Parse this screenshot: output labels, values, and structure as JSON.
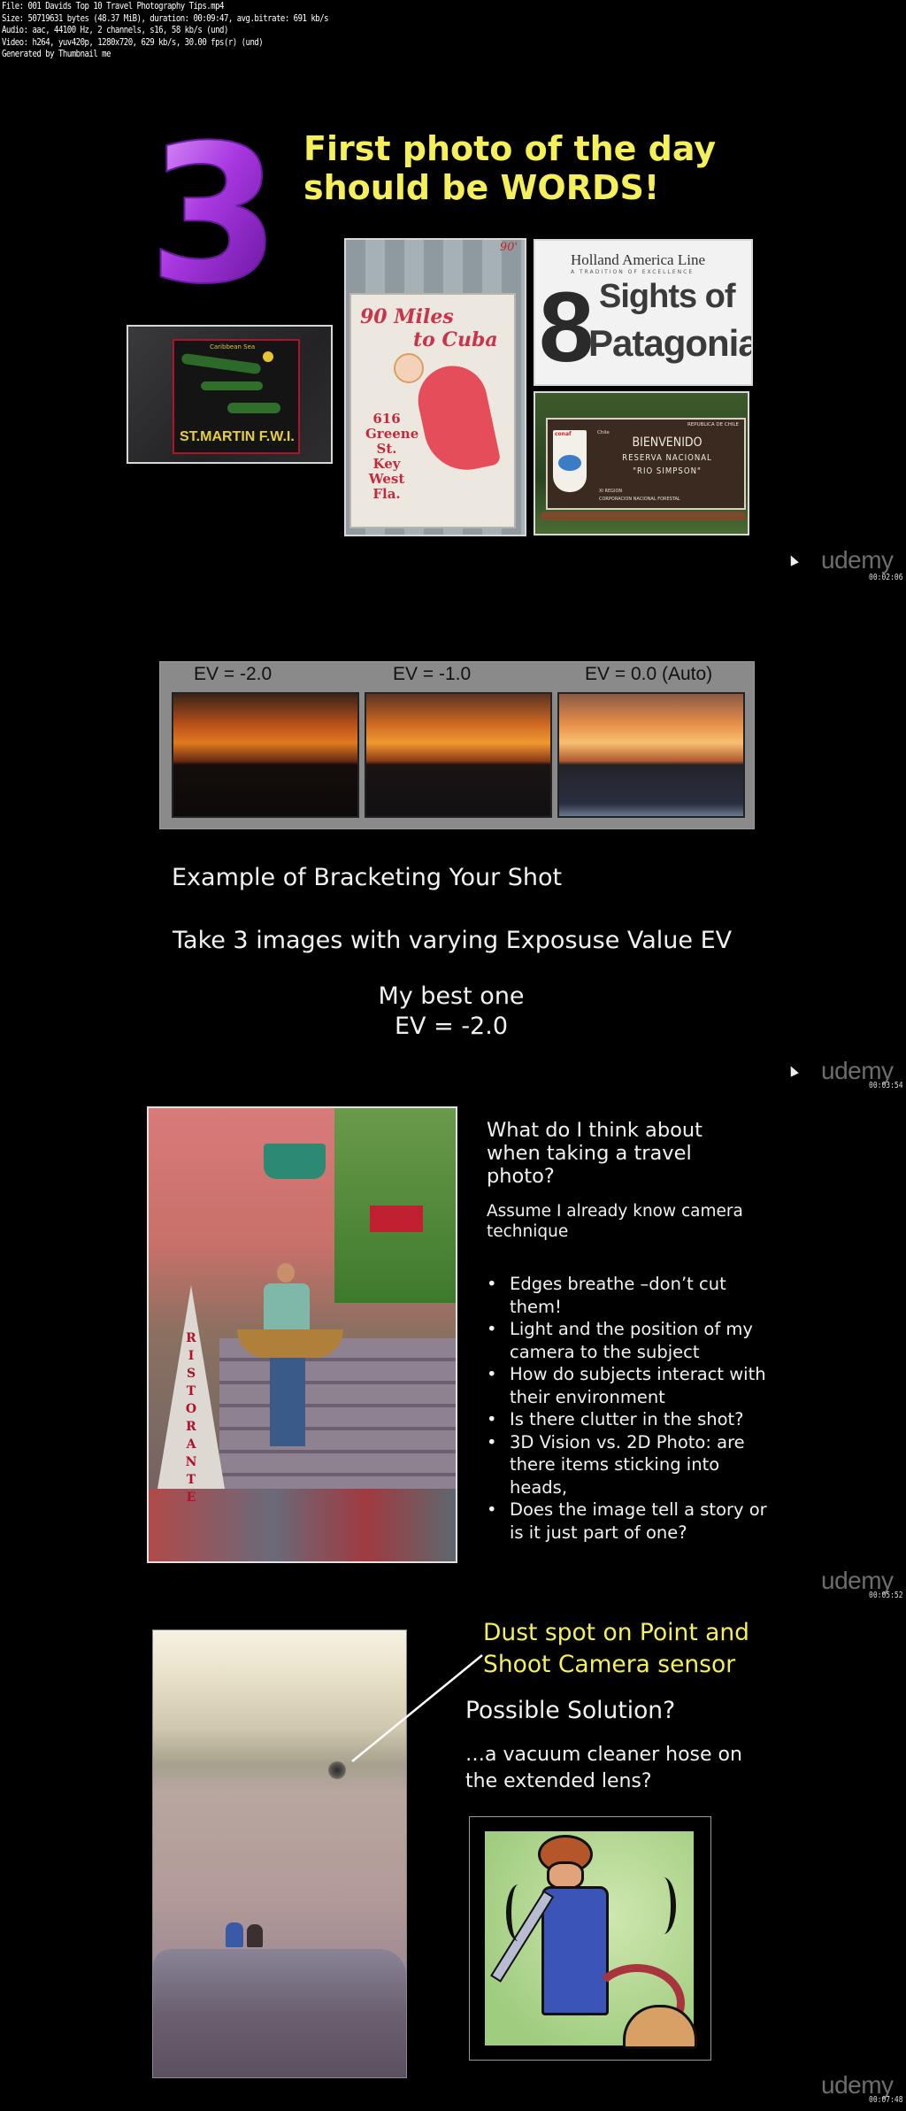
{
  "file_info": {
    "lines": [
      "File: 001 Davids Top 10 Travel Photography Tips.mp4",
      "Size: 50719631 bytes (48.37 MiB), duration: 00:09:47, avg.bitrate: 691 kb/s",
      "Audio: aac, 44100 Hz, 2 channels, s16, 58 kb/s (und)",
      "Video: h264, yuv420p, 1280x720, 629 kb/s, 30.00 fps(r) (und)",
      "Generated by Thumbnail me"
    ]
  },
  "frames": [
    {
      "big_number": "3",
      "title_line1": "First photo of the day",
      "title_line2": "should be  WORDS!",
      "photos": {
        "st_martin": "ST.MARTIN F.W.I.",
        "st_martin_map_label": "Caribbean Sea",
        "cuba_sign_line1": "90 Miles",
        "cuba_sign_line2": "to Cuba",
        "cuba_sign_address": [
          "616",
          "Greene",
          "St.",
          "Key",
          "West",
          "Fla."
        ],
        "cuba_sign_corner": "90'",
        "holland_brand": "Holland America Line",
        "holland_tagline": "A TRADITION OF EXCELLENCE",
        "holland_number": "8",
        "holland_line1": "Sights of",
        "holland_line2": "Patagonia",
        "chile_country": "REPUBLICA DE CHILE",
        "chile_logo": "conaf",
        "chile_logo_sub": "Chile",
        "chile_line1": "BIENVENIDO",
        "chile_line2": "RESERVA NACIONAL",
        "chile_line3": "\"RIO SIMPSON\"",
        "chile_line4": "XI REGION",
        "chile_line5": "CORPORACION NACIONAL FORESTAL"
      },
      "watermark": "udemy",
      "timestamp": "00:02:06"
    },
    {
      "ev_labels": [
        "EV = -2.0",
        "EV = -1.0",
        "EV = 0.0 (Auto)"
      ],
      "line1": "Example of Bracketing Your Shot",
      "line2": "Take 3 images with varying Exposuse Value EV",
      "line3": "My best one",
      "line4": "EV = -2.0",
      "watermark": "udemy",
      "timestamp": "00:03:54"
    },
    {
      "photo_sign": "RISTORANTE",
      "heading": "What do I think about when taking a travel photo?",
      "subheading": "Assume I already know camera technique",
      "bullets": [
        "Edges breathe –don’t cut them!",
        "Light and the position of my camera to the subject",
        "How do subjects interact with their environment",
        "Is there clutter in the shot?",
        "3D Vision vs. 2D Photo: are there items sticking into heads,",
        "Does the image tell a story or is it just part of one?"
      ],
      "watermark": "udemy",
      "timestamp": "00:05:52"
    },
    {
      "callout_line1": "Dust spot on Point and",
      "callout_line2": "Shoot Camera sensor",
      "question": "Possible Solution?",
      "answer_line1": "…a vacuum cleaner hose on",
      "answer_line2": "the extended lens?",
      "watermark": "udemy",
      "timestamp": "00:07:48"
    }
  ]
}
